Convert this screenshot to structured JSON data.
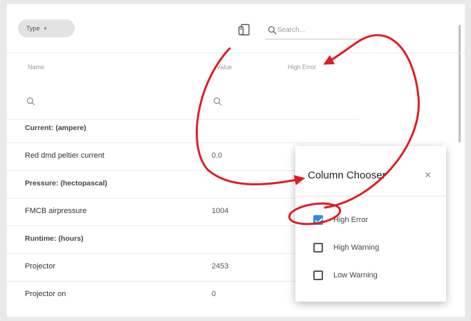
{
  "toolbar": {
    "type_chip": "Type",
    "search_placeholder": "Search..."
  },
  "columns": [
    "Name",
    "Value",
    "High Error"
  ],
  "rows": [
    {
      "kind": "group",
      "name": "Current: (ampere)",
      "value": ""
    },
    {
      "kind": "item",
      "name": "Red dmd peltier current",
      "value": "0.0"
    },
    {
      "kind": "group",
      "name": "Pressure: (hectopascal)",
      "value": ""
    },
    {
      "kind": "item",
      "name": "FMCB airpressure",
      "value": "1004"
    },
    {
      "kind": "group",
      "name": "Runtime: (hours)",
      "value": ""
    },
    {
      "kind": "item",
      "name": "Projector",
      "value": "2453"
    },
    {
      "kind": "item",
      "name": "Projector on",
      "value": "0"
    }
  ],
  "dialog": {
    "title": "Column Chooser",
    "close": "×",
    "options": [
      {
        "label": "High Error",
        "checked": true
      },
      {
        "label": "High Warning",
        "checked": false
      },
      {
        "label": "Low Warning",
        "checked": false
      }
    ]
  },
  "colors": {
    "accent": "#2d8ed8",
    "annotation": "#e01b24"
  }
}
